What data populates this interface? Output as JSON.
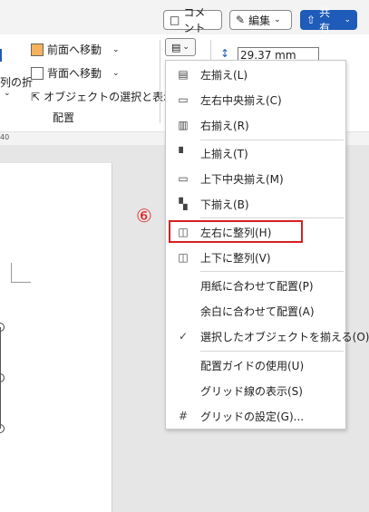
{
  "topbar": {
    "comment_label": "コメント",
    "edit_label": "編集",
    "share_label": "共有"
  },
  "ribbon": {
    "bring_forward": "前面へ移動",
    "send_backward": "背面へ移動",
    "selection_pane": "オブジェクトの選択と表示",
    "wrap_partial": "列の折",
    "group_label": "配置",
    "size_value": "29.37 mm"
  },
  "ruler": {
    "mark": "40"
  },
  "annotation": {
    "step": "⑥"
  },
  "menu": {
    "items": [
      {
        "label": "左揃え(L)",
        "icon": "align-left-icon"
      },
      {
        "label": "左右中央揃え(C)",
        "icon": "align-center-icon"
      },
      {
        "label": "右揃え(R)",
        "icon": "align-right-icon"
      },
      {
        "label": "上揃え(T)",
        "icon": "align-top-icon"
      },
      {
        "label": "上下中央揃え(M)",
        "icon": "align-middle-icon"
      },
      {
        "label": "下揃え(B)",
        "icon": "align-bottom-icon"
      },
      {
        "label": "左右に整列(H)",
        "icon": "distribute-horizontal-icon"
      },
      {
        "label": "上下に整列(V)",
        "icon": "distribute-vertical-icon"
      },
      {
        "label": "用紙に合わせて配置(P)",
        "icon": ""
      },
      {
        "label": "余白に合わせて配置(A)",
        "icon": ""
      },
      {
        "label": "選択したオブジェクトを揃える(O)",
        "icon": "checkmark-icon"
      },
      {
        "label": "配置ガイドの使用(U)",
        "icon": ""
      },
      {
        "label": "グリッド線の表示(S)",
        "icon": ""
      },
      {
        "label": "グリッドの設定(G)...",
        "icon": "grid-icon"
      }
    ]
  },
  "colors": {
    "highlight": "#d62020",
    "share_bg": "#1f5bb8",
    "step": "#e02020"
  }
}
